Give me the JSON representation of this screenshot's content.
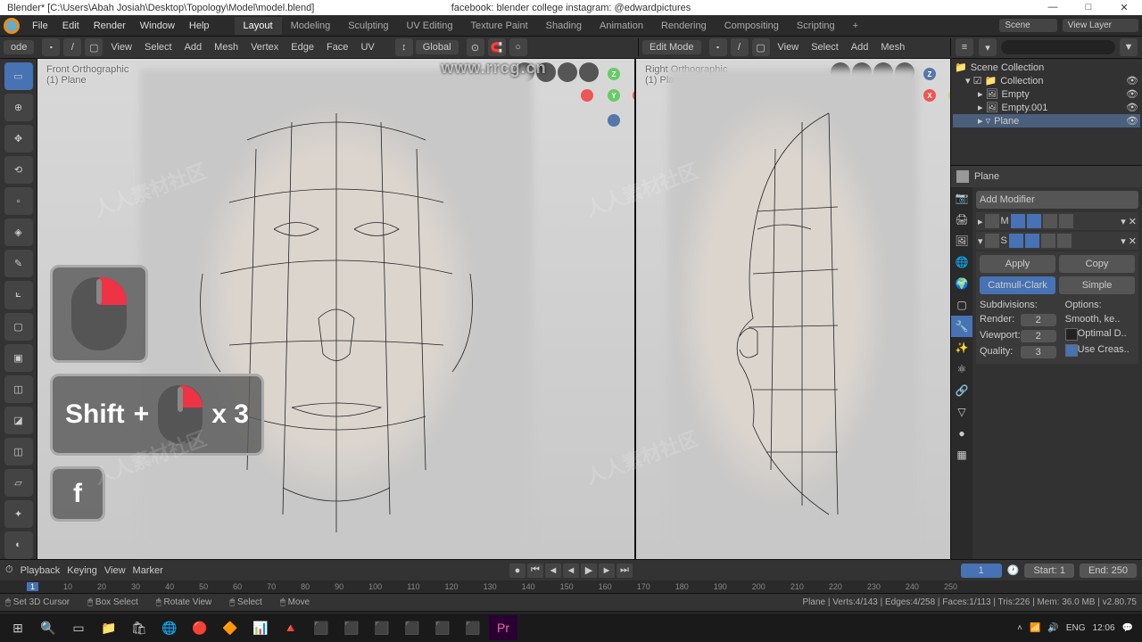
{
  "titlebar": {
    "title": "Blender* [C:\\Users\\Abah Josiah\\Desktop\\Topology\\Model\\model.blend]",
    "social": "facebook: blender college   instagram: @edwardpictures"
  },
  "menubar": {
    "items": [
      "File",
      "Edit",
      "Render",
      "Window",
      "Help"
    ],
    "tabs": [
      "Layout",
      "Modeling",
      "Sculpting",
      "UV Editing",
      "Texture Paint",
      "Shading",
      "Animation",
      "Rendering",
      "Compositing",
      "Scripting"
    ],
    "active_tab": "Layout",
    "scene": "Scene",
    "viewlayer": "View Layer"
  },
  "header_left": {
    "mode": "ode",
    "items": [
      "View",
      "Select",
      "Add",
      "Mesh",
      "Vertex",
      "Edge",
      "Face",
      "UV"
    ],
    "orientation": "Global"
  },
  "header_right": {
    "mode": "Edit Mode",
    "items": [
      "View",
      "Select",
      "Add",
      "Mesh"
    ]
  },
  "viewport1": {
    "title": "Front Orthographic",
    "subtitle": "(1) Plane"
  },
  "viewport2": {
    "title": "Right Orthographic",
    "subtitle": "(1) Plane"
  },
  "hints": {
    "shift_label": "Shift",
    "plus": "+",
    "times": "x 3",
    "f_key": "f"
  },
  "outliner": {
    "root": "Scene Collection",
    "collection": "Collection",
    "items": [
      "Empty",
      "Empty.001",
      "Plane"
    ],
    "selected": "Plane"
  },
  "props": {
    "object": "Plane",
    "add_modifier": "Add Modifier",
    "mod1": "M",
    "mod2": "S",
    "apply": "Apply",
    "copy": "Copy",
    "catmull": "Catmull-Clark",
    "simple": "Simple",
    "subdivisions_lbl": "Subdivisions:",
    "options_lbl": "Options:",
    "render_lbl": "Render:",
    "render_val": "2",
    "viewport_lbl": "Viewport:",
    "viewport_val": "2",
    "quality_lbl": "Quality:",
    "quality_val": "3",
    "smooth": "Smooth, ke..",
    "optimal": "Optimal D..",
    "usecrease": "Use Creas.."
  },
  "timeline": {
    "playback": "Playback",
    "keying": "Keying",
    "view": "View",
    "marker": "Marker",
    "current": "1",
    "start_lbl": "Start:",
    "start": "1",
    "end_lbl": "End:",
    "end": "250",
    "ruler": [
      "1",
      "10",
      "20",
      "30",
      "40",
      "50",
      "60",
      "70",
      "80",
      "90",
      "100",
      "110",
      "120",
      "130",
      "140",
      "150",
      "160",
      "170",
      "180",
      "190",
      "200",
      "210",
      "220",
      "230",
      "240",
      "250"
    ]
  },
  "statusbar": {
    "cursor": "Set 3D Cursor",
    "box": "Box Select",
    "rotate": "Rotate View",
    "select": "Select",
    "move": "Move",
    "stats": "Plane | Verts:4/143 | Edges:4/258 | Faces:1/113 | Tris:226 | Mem: 36.0 MB | v2.80.75"
  },
  "watermark": {
    "url": "www.rrcg.cn",
    "text": "人人素材社区"
  },
  "taskbar": {
    "lang": "ENG",
    "time": "12:06"
  }
}
